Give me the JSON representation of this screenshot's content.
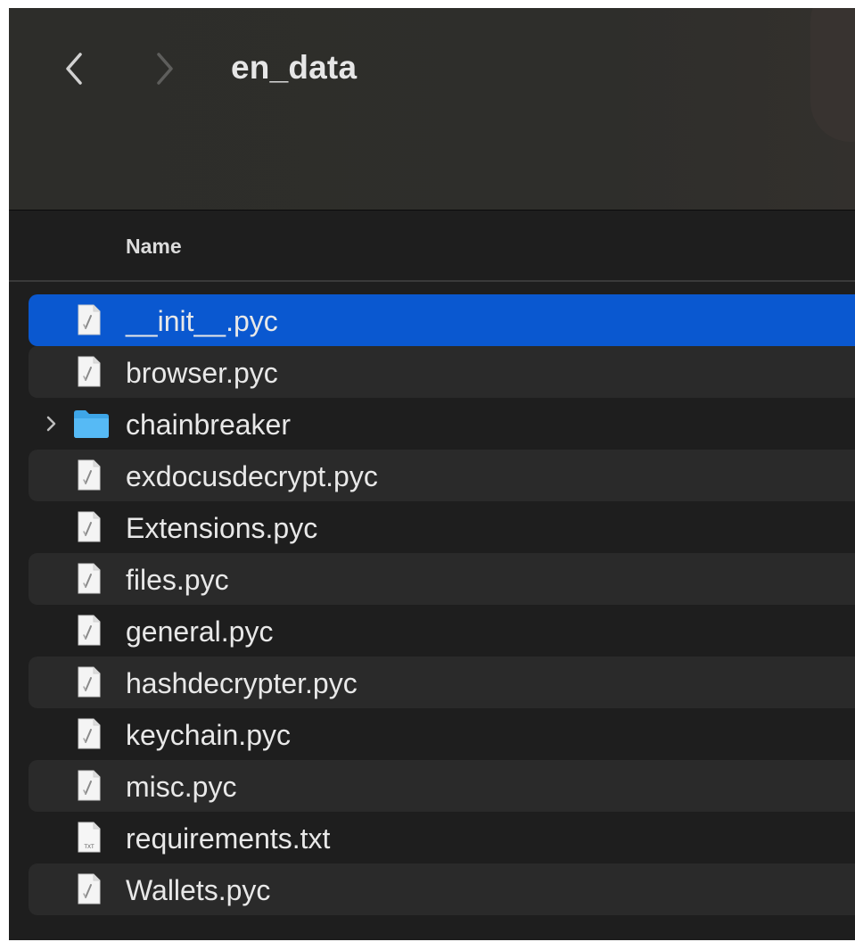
{
  "window": {
    "title": "en_data"
  },
  "toolbar": {
    "back_icon": "chevron-left-icon",
    "forward_icon": "chevron-right-icon"
  },
  "list": {
    "column_header": "Name",
    "selected_color": "#0a58d0",
    "items": [
      {
        "name": "__init__.pyc",
        "kind": "pyc",
        "icon": "python-compiled-file-icon",
        "selected": true
      },
      {
        "name": "browser.pyc",
        "kind": "pyc",
        "icon": "python-compiled-file-icon"
      },
      {
        "name": "chainbreaker",
        "kind": "folder",
        "icon": "folder-icon"
      },
      {
        "name": "exdocusdecrypt.pyc",
        "kind": "pyc",
        "icon": "python-compiled-file-icon"
      },
      {
        "name": "Extensions.pyc",
        "kind": "pyc",
        "icon": "python-compiled-file-icon"
      },
      {
        "name": "files.pyc",
        "kind": "pyc",
        "icon": "python-compiled-file-icon"
      },
      {
        "name": "general.pyc",
        "kind": "pyc",
        "icon": "python-compiled-file-icon"
      },
      {
        "name": "hashdecrypter.pyc",
        "kind": "pyc",
        "icon": "python-compiled-file-icon"
      },
      {
        "name": "keychain.pyc",
        "kind": "pyc",
        "icon": "python-compiled-file-icon"
      },
      {
        "name": "misc.pyc",
        "kind": "pyc",
        "icon": "python-compiled-file-icon"
      },
      {
        "name": "requirements.txt",
        "kind": "txt",
        "icon": "text-file-icon",
        "badge": "TXT"
      },
      {
        "name": "Wallets.pyc",
        "kind": "pyc",
        "icon": "python-compiled-file-icon"
      }
    ]
  }
}
